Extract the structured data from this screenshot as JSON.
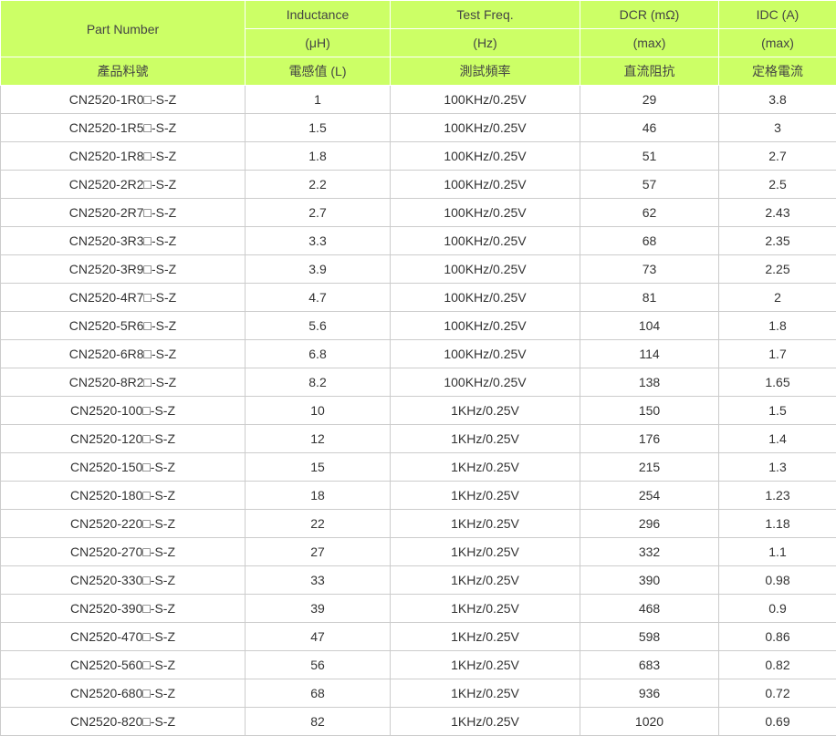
{
  "header": {
    "part_number": "Part Number",
    "inductance": "Inductance",
    "inductance_unit": "(μH)",
    "test_freq": "Test Freq.",
    "test_freq_unit": "(Hz)",
    "dcr": "DCR (mΩ)",
    "dcr_unit": "(max)",
    "idc": "IDC (A)",
    "idc_unit": "(max)",
    "zh_part": "產品料號",
    "zh_inductance": "電感值 (L)",
    "zh_test_freq": "測試頻率",
    "zh_dcr": "直流阻抗",
    "zh_idc": "定格電流"
  },
  "colors": {
    "header_bg": "#ccff66",
    "border": "#cccccc"
  },
  "rows": [
    [
      "CN2520-1R0□-S-Z",
      "1",
      "100KHz/0.25V",
      "29",
      "3.8"
    ],
    [
      "CN2520-1R5□-S-Z",
      "1.5",
      "100KHz/0.25V",
      "46",
      "3"
    ],
    [
      "CN2520-1R8□-S-Z",
      "1.8",
      "100KHz/0.25V",
      "51",
      "2.7"
    ],
    [
      "CN2520-2R2□-S-Z",
      "2.2",
      "100KHz/0.25V",
      "57",
      "2.5"
    ],
    [
      "CN2520-2R7□-S-Z",
      "2.7",
      "100KHz/0.25V",
      "62",
      "2.43"
    ],
    [
      "CN2520-3R3□-S-Z",
      "3.3",
      "100KHz/0.25V",
      "68",
      "2.35"
    ],
    [
      "CN2520-3R9□-S-Z",
      "3.9",
      "100KHz/0.25V",
      "73",
      "2.25"
    ],
    [
      "CN2520-4R7□-S-Z",
      "4.7",
      "100KHz/0.25V",
      "81",
      "2"
    ],
    [
      "CN2520-5R6□-S-Z",
      "5.6",
      "100KHz/0.25V",
      "104",
      "1.8"
    ],
    [
      "CN2520-6R8□-S-Z",
      "6.8",
      "100KHz/0.25V",
      "114",
      "1.7"
    ],
    [
      "CN2520-8R2□-S-Z",
      "8.2",
      "100KHz/0.25V",
      "138",
      "1.65"
    ],
    [
      "CN2520-100□-S-Z",
      "10",
      "1KHz/0.25V",
      "150",
      "1.5"
    ],
    [
      "CN2520-120□-S-Z",
      "12",
      "1KHz/0.25V",
      "176",
      "1.4"
    ],
    [
      "CN2520-150□-S-Z",
      "15",
      "1KHz/0.25V",
      "215",
      "1.3"
    ],
    [
      "CN2520-180□-S-Z",
      "18",
      "1KHz/0.25V",
      "254",
      "1.23"
    ],
    [
      "CN2520-220□-S-Z",
      "22",
      "1KHz/0.25V",
      "296",
      "1.18"
    ],
    [
      "CN2520-270□-S-Z",
      "27",
      "1KHz/0.25V",
      "332",
      "1.1"
    ],
    [
      "CN2520-330□-S-Z",
      "33",
      "1KHz/0.25V",
      "390",
      "0.98"
    ],
    [
      "CN2520-390□-S-Z",
      "39",
      "1KHz/0.25V",
      "468",
      "0.9"
    ],
    [
      "CN2520-470□-S-Z",
      "47",
      "1KHz/0.25V",
      "598",
      "0.86"
    ],
    [
      "CN2520-560□-S-Z",
      "56",
      "1KHz/0.25V",
      "683",
      "0.82"
    ],
    [
      "CN2520-680□-S-Z",
      "68",
      "1KHz/0.25V",
      "936",
      "0.72"
    ],
    [
      "CN2520-820□-S-Z",
      "82",
      "1KHz/0.25V",
      "1020",
      "0.69"
    ]
  ]
}
